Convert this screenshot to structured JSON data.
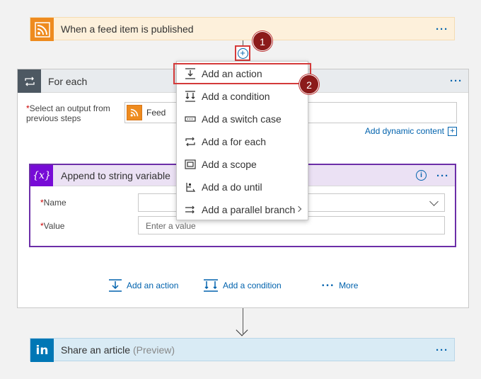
{
  "trigger": {
    "title": "When a feed item is published",
    "more": "···"
  },
  "badges": {
    "one": "1",
    "two": "2"
  },
  "connector": {
    "plus": "+"
  },
  "foreach": {
    "title": "For each",
    "more": "···",
    "output_label_req": "*",
    "output_label": "Select an output from previous steps",
    "token_text": "Feed",
    "add_dynamic": "Add dynamic content",
    "add_dynamic_icon": "+"
  },
  "append": {
    "icon": "{x}",
    "title": "Append to string variable",
    "info": "i",
    "more": "···",
    "name_req": "*",
    "name_label": "Name",
    "value_req": "*",
    "value_label": "Value",
    "value_placeholder": "Enter a value"
  },
  "bottom_actions": {
    "add_action": "Add an action",
    "add_condition": "Add a condition",
    "more": "More",
    "more_dots": "• • •"
  },
  "share": {
    "icon": "in",
    "title": "Share an article",
    "preview": "(Preview)",
    "more": "···"
  },
  "menu": {
    "items": [
      {
        "label": "Add an action",
        "icon": "action-icon"
      },
      {
        "label": "Add a condition",
        "icon": "condition-icon"
      },
      {
        "label": "Add a switch case",
        "icon": "switch-icon"
      },
      {
        "label": "Add a for each",
        "icon": "foreach-icon"
      },
      {
        "label": "Add a scope",
        "icon": "scope-icon"
      },
      {
        "label": "Add a do until",
        "icon": "dountil-icon"
      },
      {
        "label": "Add a parallel branch",
        "icon": "parallel-icon"
      }
    ]
  },
  "colors": {
    "accent": "#0062ad",
    "rss": "#ee8b1f",
    "variable": "#770bd6",
    "linkedin": "#0077b5",
    "highlight": "#d43a3a",
    "badge": "#8b1a1a"
  }
}
